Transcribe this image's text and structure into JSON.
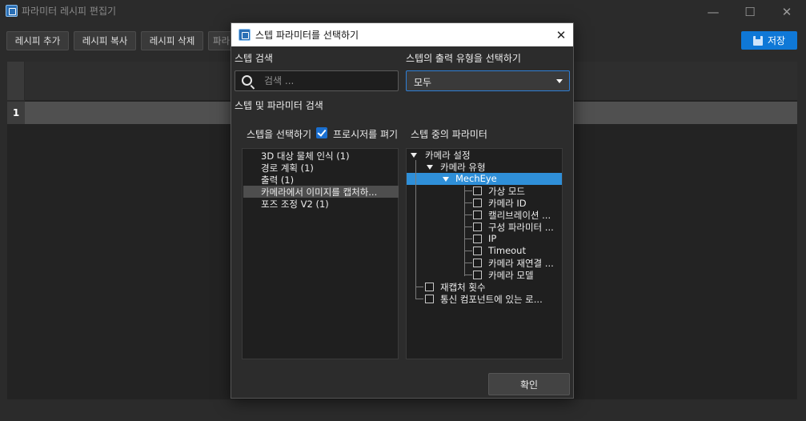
{
  "main_window": {
    "title": "파라미터 레시피 편집기",
    "controls": {
      "minimize": "—",
      "maximize": "☐",
      "close": "✕"
    }
  },
  "toolbar": {
    "add_label": "레시피 추가",
    "copy_label": "레시피 복사",
    "delete_label": "레시피 삭제",
    "partial_label": "파라",
    "save_label": "저장"
  },
  "table": {
    "row_number": "1"
  },
  "dialog": {
    "title": "스텝 파라미터를 선택하기",
    "close_label": "✕",
    "step_search_label": "스텝 검색",
    "search_placeholder": "검색 ...",
    "output_type_label": "스텝의 출력 유형을 선택하기",
    "output_type_value": "모두",
    "step_param_search_label": "스텝 및 파라미터 검색",
    "select_step_label": "스텝을 선택하기",
    "collapse_label": "프로시저를 펴기",
    "params_in_step_label": "스텝 중의 파라미터",
    "steps": [
      {
        "label": "3D 대상 물체 인식 (1)"
      },
      {
        "label": "경로 계획 (1)"
      },
      {
        "label": "출력 (1)"
      },
      {
        "label": "카메라에서 이미지를 캡처하..."
      },
      {
        "label": "포즈 조정 V2 (1)"
      }
    ],
    "tree": {
      "camera_settings": "카메라 설정",
      "camera_type": "카메라 유형",
      "mecheye": "MechEye",
      "params": [
        "가상 모드",
        "카메라 ID",
        "캘리브레이션 ...",
        "구성 파라미터 ...",
        "IP",
        "Timeout",
        "카메라 재연결 ...",
        "카메라 모델"
      ],
      "recapture_count": "재캡처 횟수",
      "comm_component": "통신 컴포넌트에 있는 로..."
    },
    "ok_label": "확인"
  },
  "colors": {
    "accent": "#0f78d7",
    "selection": "#2f8fd8",
    "background": "#2b2b2b",
    "panel": "#1f1f1f"
  }
}
